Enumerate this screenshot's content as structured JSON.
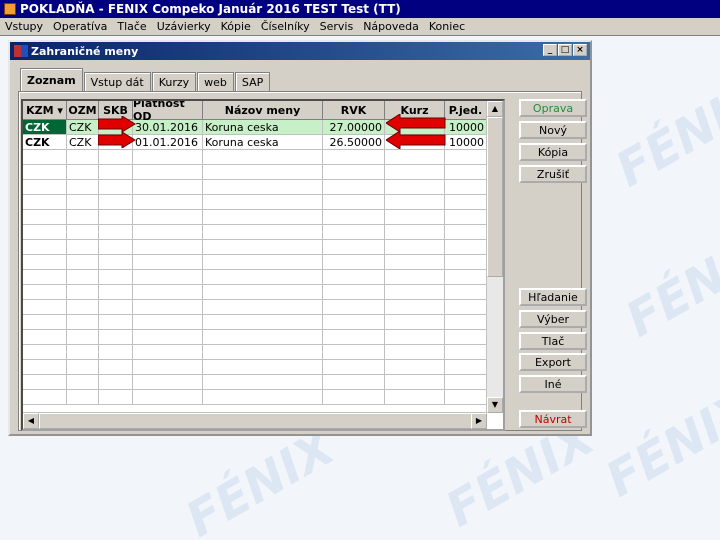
{
  "app": {
    "title": "POKLADŇA - FENIX Compeko  Január 2016  TEST Test  (TT)",
    "menu": [
      "Vstupy",
      "Operatíva",
      "Tlače",
      "Uzávierky",
      "Kópie",
      "Číselníky",
      "Servis",
      "Nápoveda",
      "Koniec"
    ]
  },
  "window": {
    "title": "Zahraničné meny",
    "minimize": "_",
    "maximize": "□",
    "close": "×"
  },
  "watermark": "FÉNIX",
  "tabs": [
    "Zoznam",
    "Vstup dát",
    "Kurzy",
    "web",
    "SAP"
  ],
  "grid": {
    "columns": [
      "KZM ▾",
      "OZM",
      "SKB",
      "Platnosť OD",
      "Názov meny",
      "RVK",
      "Kurz",
      "P.jed."
    ],
    "rows": [
      [
        "CZK",
        "CZK",
        "",
        "30.01.2016",
        "Koruna ceska",
        "27.00000",
        "",
        "10000"
      ],
      [
        "CZK",
        "CZK",
        "",
        "01.01.2016",
        "Koruna ceska",
        "26.50000",
        "",
        "10000"
      ]
    ],
    "empty_rows": 17
  },
  "buttons": {
    "oprava": "Oprava",
    "novy": "Nový",
    "kopia": "Kópia",
    "zrusit": "Zrušiť",
    "hladanie": "Hľadanie",
    "vyber": "Výber",
    "tlac": "Tlač",
    "export": "Export",
    "ine": "Iné",
    "navrat": "Návrat"
  },
  "colors": {
    "arrow": "#e00000",
    "selected_row": "#c8f0c8",
    "title_bar": "#000080"
  }
}
